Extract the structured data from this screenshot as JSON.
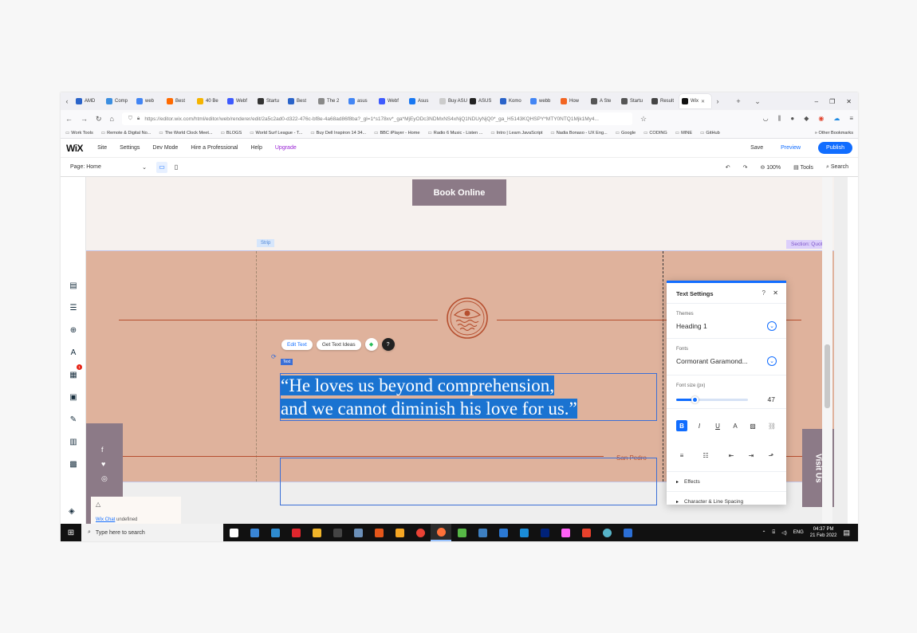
{
  "browser": {
    "tabs": [
      {
        "label": "AMD",
        "color": "#2a63c9"
      },
      {
        "label": "Comp",
        "color": "#3b8ee0"
      },
      {
        "label": "web",
        "color": "#4285f4"
      },
      {
        "label": "Best",
        "color": "#ff6a00"
      },
      {
        "label": "40 Be",
        "color": "#f5b400"
      },
      {
        "label": "Webf",
        "color": "#3d5afe"
      },
      {
        "label": "Startu",
        "color": "#333333"
      },
      {
        "label": "Best",
        "color": "#2a63c9"
      },
      {
        "label": "The 2",
        "color": "#888888"
      },
      {
        "label": "asus",
        "color": "#4285f4"
      },
      {
        "label": "Webf",
        "color": "#3d5afe"
      },
      {
        "label": "Asus",
        "color": "#1877f2"
      },
      {
        "label": "Buy ASUS",
        "color": "#cccccc"
      },
      {
        "label": "ASUS",
        "color": "#222222"
      },
      {
        "label": "Komo",
        "color": "#2a63c9"
      },
      {
        "label": "webb",
        "color": "#4285f4"
      },
      {
        "label": "How",
        "color": "#f26522"
      },
      {
        "label": "A Ste",
        "color": "#555555"
      },
      {
        "label": "Startu",
        "color": "#555555"
      },
      {
        "label": "Result",
        "color": "#444444"
      },
      {
        "label": "Wix",
        "color": "#111111",
        "active": true
      }
    ],
    "url": "https://editor.wix.com/html/editor/web/renderer/edit/2a5c2ad0-d322-476c-bf8e-4a68ad86f8ba?_gl=1*s178xv*_ga*MjEyODc3NDMxNS4xNjQ1NDUyNjQ0*_ga_H5143KQHSPY*MTY0NTQ1Mjk1My4...",
    "bookmarks": [
      "Work Tools",
      "Remote & Digital No...",
      "The World Clock Meet...",
      "BLOGS",
      "World Surf League - T...",
      "Buy Dell Inspiron 14 34...",
      "BBC iPlayer - Home",
      "Radio 6 Music - Listen ...",
      "Intro | Learn JavaScript",
      "Nadia Bonaso - UX Eng...",
      "Google",
      "CODING",
      "MINE",
      "GitHub"
    ],
    "other_bookmarks": "Other Bookmarks"
  },
  "wix": {
    "logo": "WiX",
    "menu": [
      "Site",
      "Settings",
      "Dev Mode",
      "Hire a Professional",
      "Help",
      "Upgrade"
    ],
    "save": "Save",
    "preview": "Preview",
    "publish": "Publish",
    "page": "Page: Home",
    "zoom": "100%",
    "tools": "Tools",
    "search": "Search",
    "accent": "#116dff"
  },
  "canvas": {
    "book_online": "Book Online",
    "strip_label": "Strip",
    "section_label": "Section: Quote",
    "edit_text": "Edit Text",
    "get_text_ideas": "Get Text Ideas",
    "text_tag": "Text",
    "quote_line1": "“He loves us beyond comprehension,",
    "quote_line2": "and we cannot diminish his love for us.”",
    "author": "San Pedro",
    "visit_us": "Visit Us",
    "quote_bg": "#dfb29c",
    "accent_line": "#b64f2f"
  },
  "panel": {
    "title": "Text Settings",
    "help": "?",
    "close": "✕",
    "themes_label": "Themes",
    "themes_value": "Heading 1",
    "fonts_label": "Fonts",
    "fonts_value": "Cormorant Garamond...",
    "fontsize_label": "Font size (px)",
    "fontsize_value": "47",
    "fontsize_fraction": 0.26,
    "effects": "Effects",
    "spacing": "Character & Line Spacing"
  },
  "chat": {
    "link": "Wix Chat",
    "status": "undefined"
  },
  "taskbar": {
    "search_placeholder": "Type here to search",
    "lang": "ENG",
    "time": "04:37 PM",
    "date": "21 Feb 2022"
  }
}
